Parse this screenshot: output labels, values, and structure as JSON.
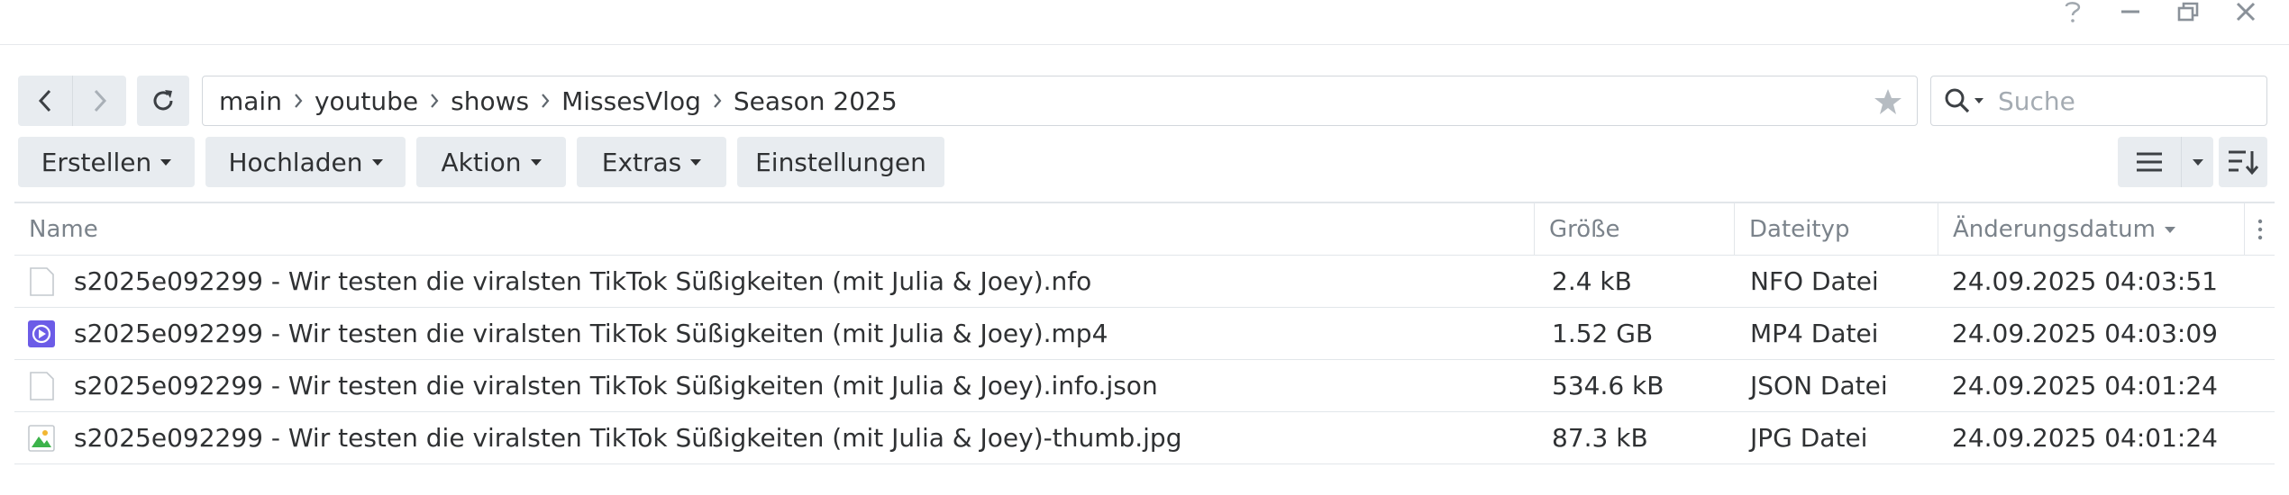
{
  "window": {
    "help_icon": "question-icon",
    "minimize_icon": "minimize-icon",
    "restore_icon": "restore-icon",
    "close_icon": "close-icon"
  },
  "nav": {
    "back_icon": "chevron-left-icon",
    "forward_icon": "chevron-right-icon",
    "refresh_icon": "refresh-icon"
  },
  "breadcrumb": [
    "main",
    "youtube",
    "shows",
    "MissesVlog",
    "Season 2025"
  ],
  "search": {
    "placeholder": "Suche"
  },
  "toolbar": {
    "create": "Erstellen",
    "upload": "Hochladen",
    "action": "Aktion",
    "extras": "Extras",
    "settings": "Einstellungen"
  },
  "table": {
    "columns": {
      "name": "Name",
      "size": "Größe",
      "type": "Dateityp",
      "modified": "Änderungsdatum"
    },
    "rows": [
      {
        "icon": "document-icon",
        "name": "s2025e092299 - Wir testen die viralsten TikTok Süßigkeiten (mit Julia & Joey).nfo",
        "size": "2.4 kB",
        "type": "NFO Datei",
        "modified": "24.09.2025 04:03:51"
      },
      {
        "icon": "video-icon",
        "name": "s2025e092299 - Wir testen die viralsten TikTok Süßigkeiten (mit Julia & Joey).mp4",
        "size": "1.52 GB",
        "type": "MP4 Datei",
        "modified": "24.09.2025 04:03:09"
      },
      {
        "icon": "document-icon",
        "name": "s2025e092299 - Wir testen die viralsten TikTok Süßigkeiten (mit Julia & Joey).info.json",
        "size": "534.6 kB",
        "type": "JSON Datei",
        "modified": "24.09.2025 04:01:24"
      },
      {
        "icon": "image-icon",
        "name": "s2025e092299 - Wir testen die viralsten TikTok Süßigkeiten (mit Julia & Joey)-thumb.jpg",
        "size": "87.3 kB",
        "type": "JPG Datei",
        "modified": "24.09.2025 04:01:24"
      }
    ]
  },
  "colors": {
    "button_bg": "#e8ecf0",
    "border": "#e2e6ea",
    "text": "#2f3133",
    "muted": "#7b838b",
    "video_icon": "#6c5ce7",
    "image_icon_green": "#3cb34a"
  }
}
